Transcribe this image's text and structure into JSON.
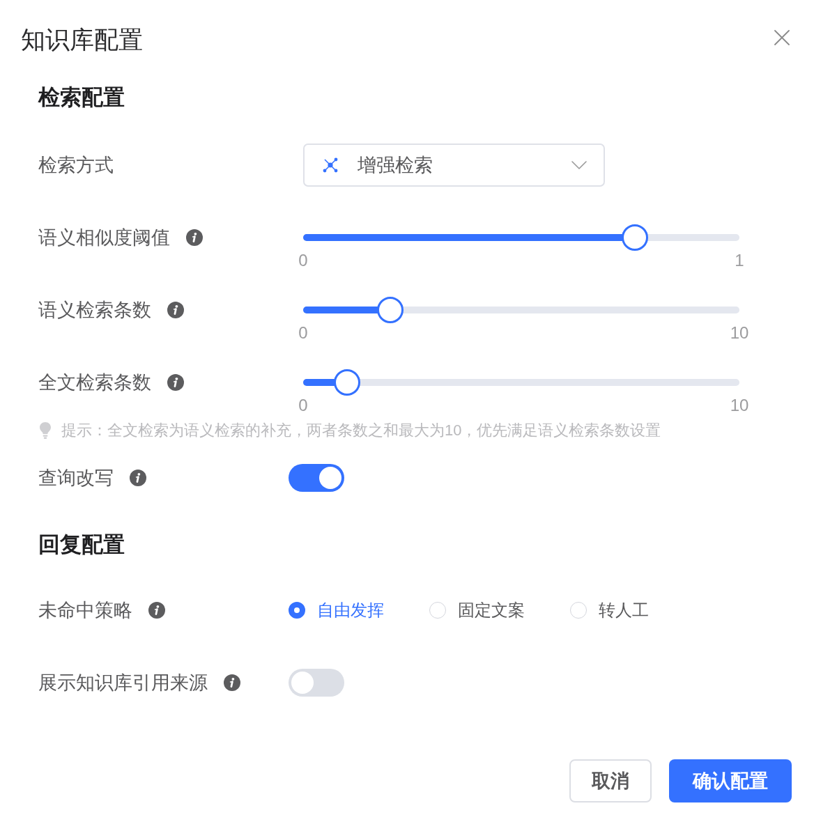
{
  "dialog": {
    "title": "知识库配置"
  },
  "sections": [
    {
      "title": "检索配置",
      "fields": [
        {
          "kind": "select",
          "label": "检索方式",
          "value": "增强检索"
        },
        {
          "kind": "slider",
          "label": "语义相似度阈值",
          "info": true,
          "level": 0.76,
          "min_label": "0",
          "max_label": "1"
        },
        {
          "kind": "slider",
          "label": "语义检索条数",
          "info": true,
          "level": 0.2,
          "min_label": "0",
          "max_label": "10"
        },
        {
          "kind": "slider",
          "label": "全文检索条数",
          "info": true,
          "level": 0.1,
          "min_label": "0",
          "max_label": "10"
        },
        {
          "kind": "hint",
          "text": "提示：全文检索为语义检索的补充，两者条数之和最大为10，优先满足语义检索条数设置"
        },
        {
          "kind": "switch",
          "label": "查询改写",
          "info": true,
          "on": true
        }
      ]
    },
    {
      "title": "回复配置",
      "fields": [
        {
          "kind": "radio",
          "label": "未命中策略",
          "info": true,
          "options": [
            {
              "label": "自由发挥",
              "selected": true
            },
            {
              "label": "固定文案",
              "selected": false
            },
            {
              "label": "转人工",
              "selected": false
            }
          ]
        },
        {
          "kind": "switch",
          "label": "展示知识库引用来源",
          "info": true,
          "on": false
        }
      ]
    }
  ],
  "buttons": [
    {
      "kind": "secondary",
      "label": "取消"
    },
    {
      "kind": "primary",
      "label": "确认配置"
    }
  ]
}
